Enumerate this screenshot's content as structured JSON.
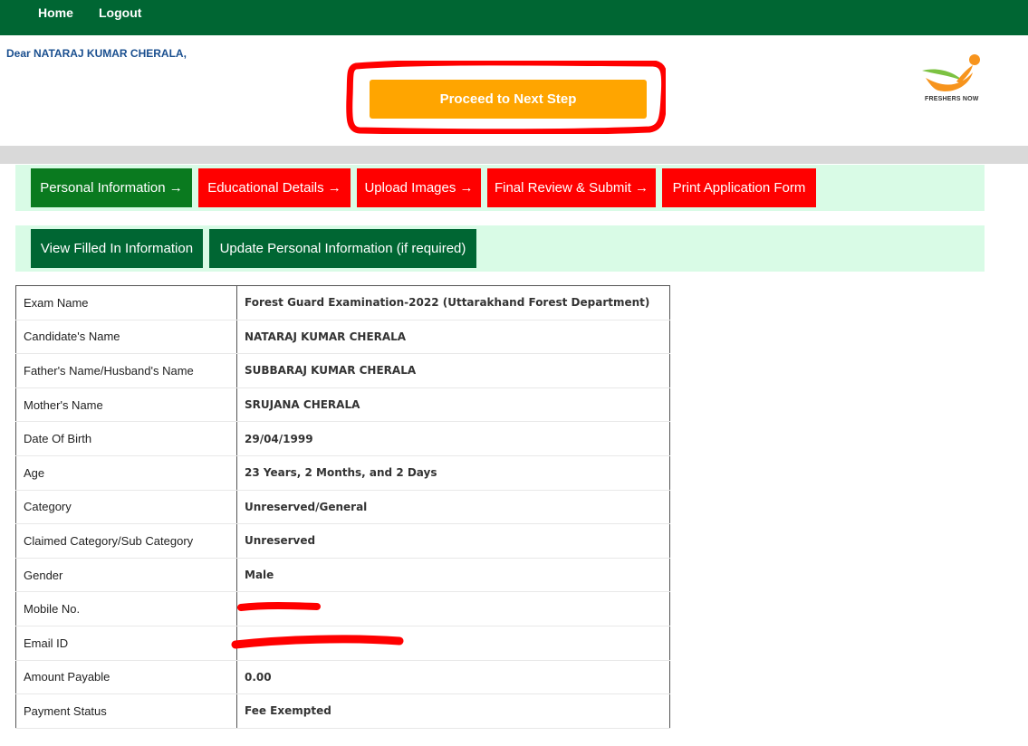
{
  "nav": {
    "home": "Home",
    "logout": "Logout"
  },
  "greeting": "Dear NATARAJ KUMAR CHERALA,",
  "proceed_label": "Proceed to Next Step",
  "logo": {
    "text": "FRESHERS NOW"
  },
  "colors": {
    "nav_bg": "#006633",
    "proceed": "#ffa500",
    "step_active": "#0a7a1f",
    "step_inactive": "#ff0000",
    "bar_bg": "#d9fbe6",
    "annotation": "#ff0000"
  },
  "steps": [
    {
      "label": "Personal Information →",
      "state": "active"
    },
    {
      "label": "Educational Details →",
      "state": "pending"
    },
    {
      "label": "Upload Images →",
      "state": "pending"
    },
    {
      "label": "Final Review & Submit →",
      "state": "pending"
    },
    {
      "label": "Print Application Form",
      "state": "pending"
    }
  ],
  "sub_actions": [
    {
      "label": "View Filled In Information"
    },
    {
      "label": "Update Personal Information (if required)"
    }
  ],
  "details": [
    {
      "label": "Exam Name",
      "value": "Forest Guard Examination-2022 (Uttarakhand Forest Department)"
    },
    {
      "label": "Candidate's Name",
      "value": "NATARAJ KUMAR CHERALA"
    },
    {
      "label": "Father's Name/Husband's Name",
      "value": "SUBBARAJ KUMAR CHERALA"
    },
    {
      "label": "Mother's Name",
      "value": "SRUJANA CHERALA"
    },
    {
      "label": "Date Of Birth",
      "value": "29/04/1999"
    },
    {
      "label": "Age",
      "value": "23 Years, 2 Months, and 2 Days"
    },
    {
      "label": "Category",
      "value": "Unreserved/General"
    },
    {
      "label": "Claimed Category/Sub Category",
      "value": "Unreserved"
    },
    {
      "label": "Gender",
      "value": "Male"
    },
    {
      "label": "Mobile No.",
      "value": ""
    },
    {
      "label": "Email ID",
      "value": ""
    },
    {
      "label": "Amount Payable",
      "value": "0.00"
    },
    {
      "label": "Payment Status",
      "value": "Fee Exempted"
    }
  ]
}
